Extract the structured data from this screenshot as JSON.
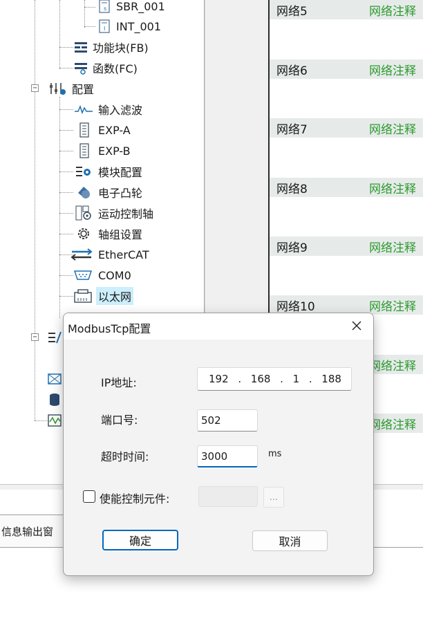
{
  "tree": {
    "items": [
      {
        "label": "SBR_001",
        "icon": "sbr-subroutine-icon"
      },
      {
        "label": "INT_001",
        "icon": "int-interrupt-icon"
      },
      {
        "label": "功能块(FB)",
        "icon": "function-block-icon"
      },
      {
        "label": "函数(FC)",
        "icon": "function-icon"
      },
      {
        "label": "配置",
        "icon": "config-sliders-icon"
      },
      {
        "label": "输入滤波",
        "icon": "input-filter-icon"
      },
      {
        "label": "EXP-A",
        "icon": "expansion-module-icon"
      },
      {
        "label": "EXP-B",
        "icon": "expansion-module-icon"
      },
      {
        "label": "模块配置",
        "icon": "module-config-icon"
      },
      {
        "label": "电子凸轮",
        "icon": "electronic-cam-icon"
      },
      {
        "label": "运动控制轴",
        "icon": "motion-axis-icon"
      },
      {
        "label": "轴组设置",
        "icon": "axis-group-gear-icon"
      },
      {
        "label": "EtherCAT",
        "icon": "ethercat-arrows-icon"
      },
      {
        "label": "COM0",
        "icon": "serial-port-icon"
      },
      {
        "label": "以太网",
        "icon": "ethernet-port-icon"
      }
    ]
  },
  "networks": [
    {
      "name": "网络5",
      "comment": "网络注释"
    },
    {
      "name": "网络6",
      "comment": "网络注释"
    },
    {
      "name": "网络7",
      "comment": "网络注释"
    },
    {
      "name": "网络8",
      "comment": "网络注释"
    },
    {
      "name": "网络9",
      "comment": "网络注释"
    },
    {
      "name": "网络10",
      "comment": "网络注释"
    },
    {
      "name": "",
      "comment": "网络注释"
    },
    {
      "name": "",
      "comment": "网络注释"
    }
  ],
  "output_tab": {
    "label": "信息输出窗"
  },
  "dialog": {
    "title": "ModbusTcp配置",
    "ip_label": "IP地址:",
    "ip": [
      "192",
      "168",
      "1",
      "188"
    ],
    "port_label": "端口号:",
    "port_value": "502",
    "timeout_label": "超时时间:",
    "timeout_value": "3000",
    "timeout_unit": "ms",
    "enable_label": "使能控制元件:",
    "enable_checked": false,
    "enable_value": "",
    "browse_label": "...",
    "ok_label": "确定",
    "cancel_label": "取消"
  },
  "colors": {
    "comment_green": "#2e9a2e",
    "network_header_bg": "#e6ebea",
    "selection_bg": "#cdeefb",
    "focus_blue": "#0067c0"
  }
}
